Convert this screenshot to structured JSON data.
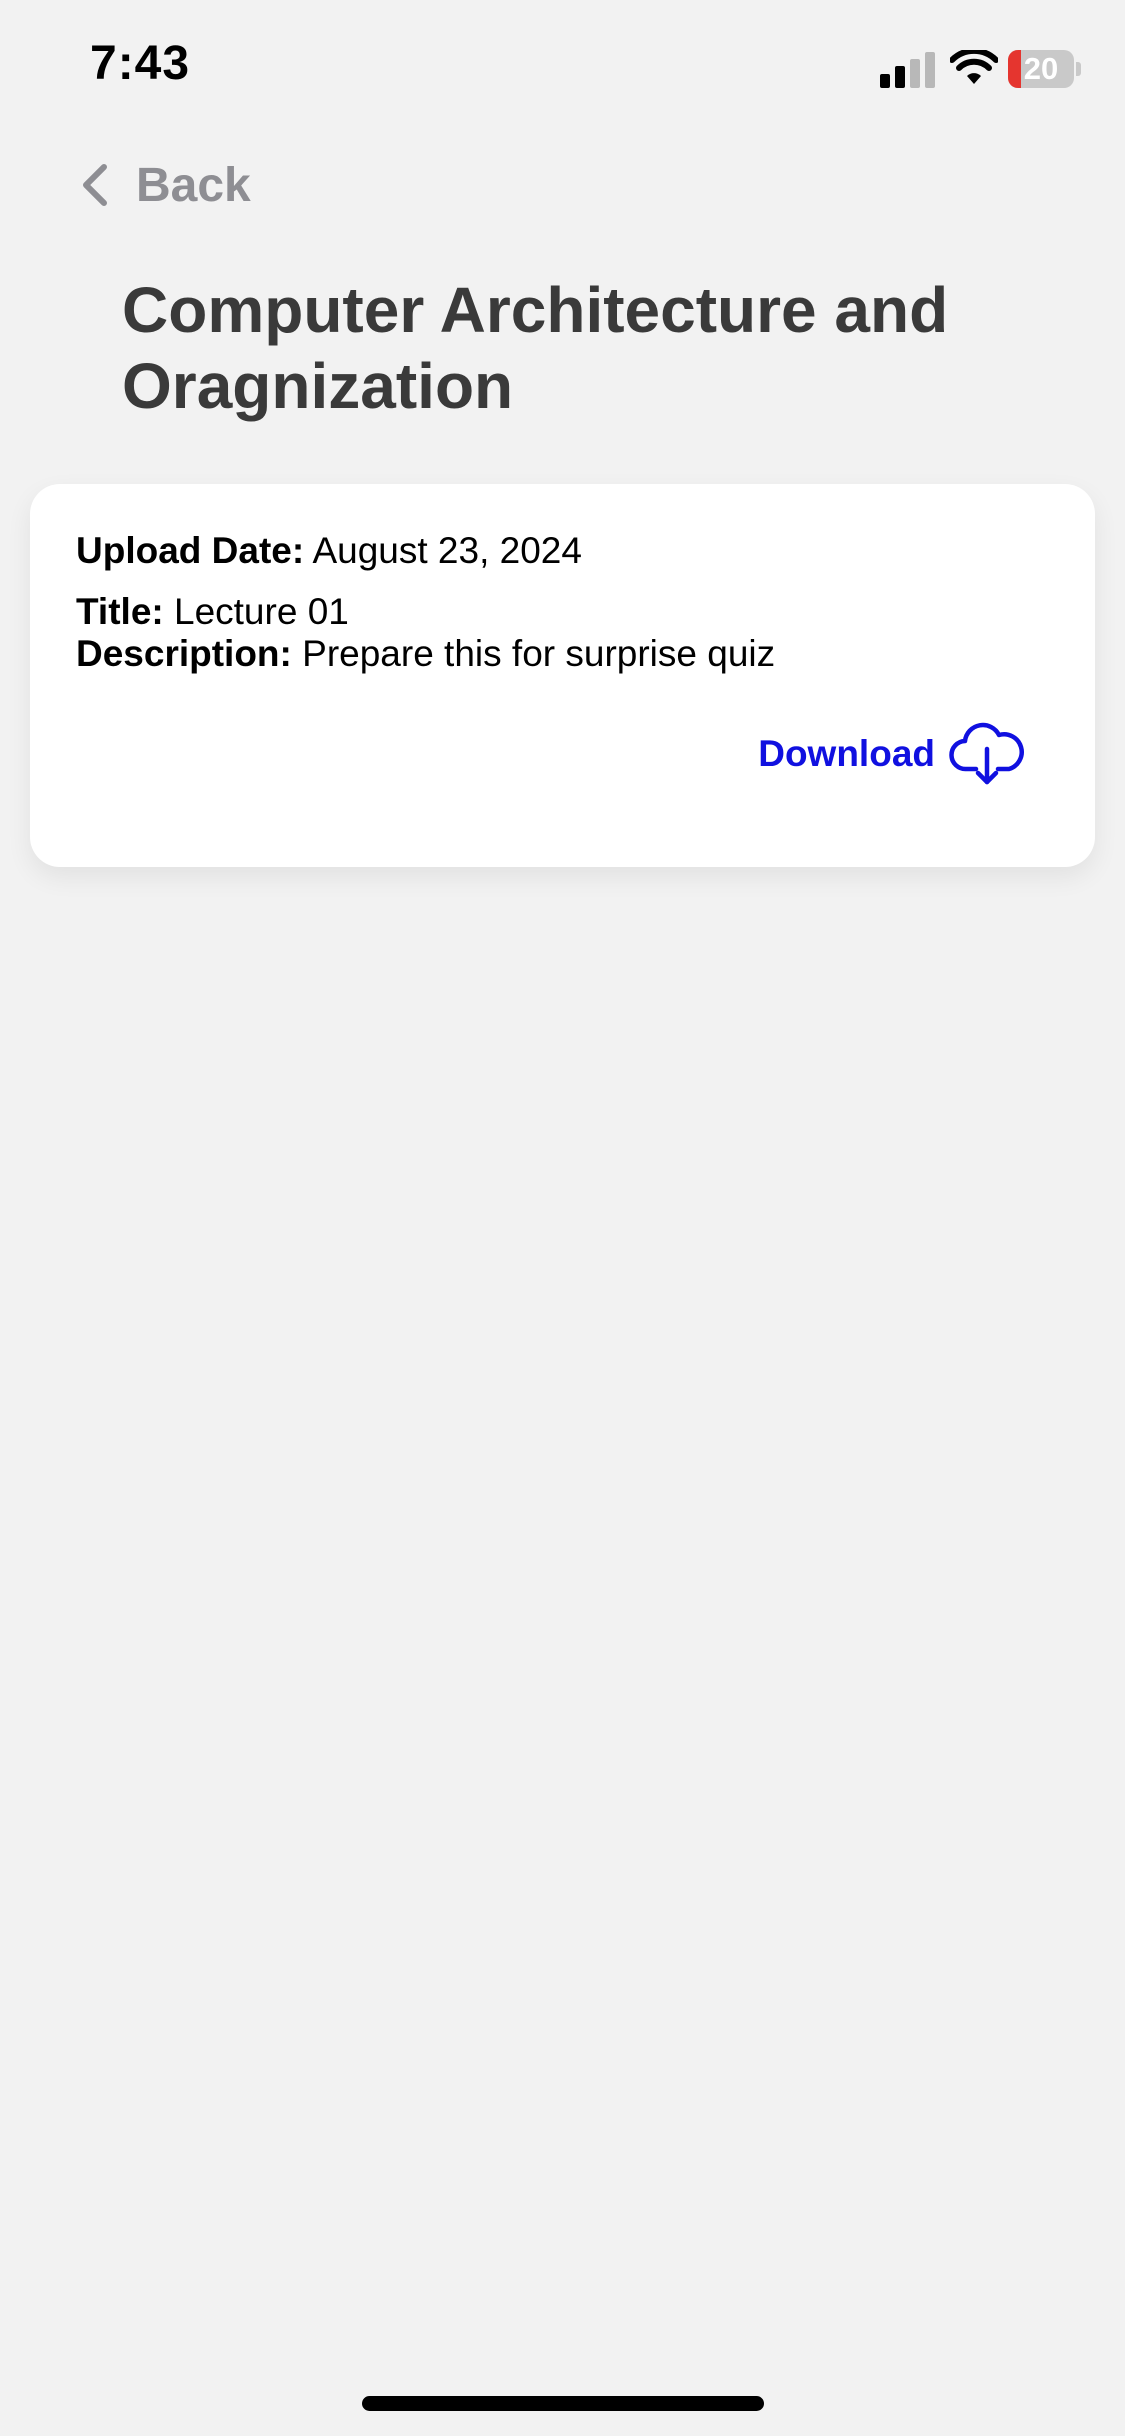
{
  "status_bar": {
    "time": "7:43",
    "battery_level": "20",
    "battery_fraction": 0.2,
    "battery_color": "#e5352f"
  },
  "nav": {
    "back_label": "Back"
  },
  "page": {
    "title": "Computer Architecture and Oragnization"
  },
  "card": {
    "upload_date_label": "Upload Date:",
    "upload_date_value": "August 23, 2024",
    "title_label": "Title:",
    "title_value": "Lecture 01",
    "description_label": "Description:",
    "description_value": "Prepare this for surprise quiz",
    "download_label": "Download",
    "accent_color": "#1010e0"
  }
}
